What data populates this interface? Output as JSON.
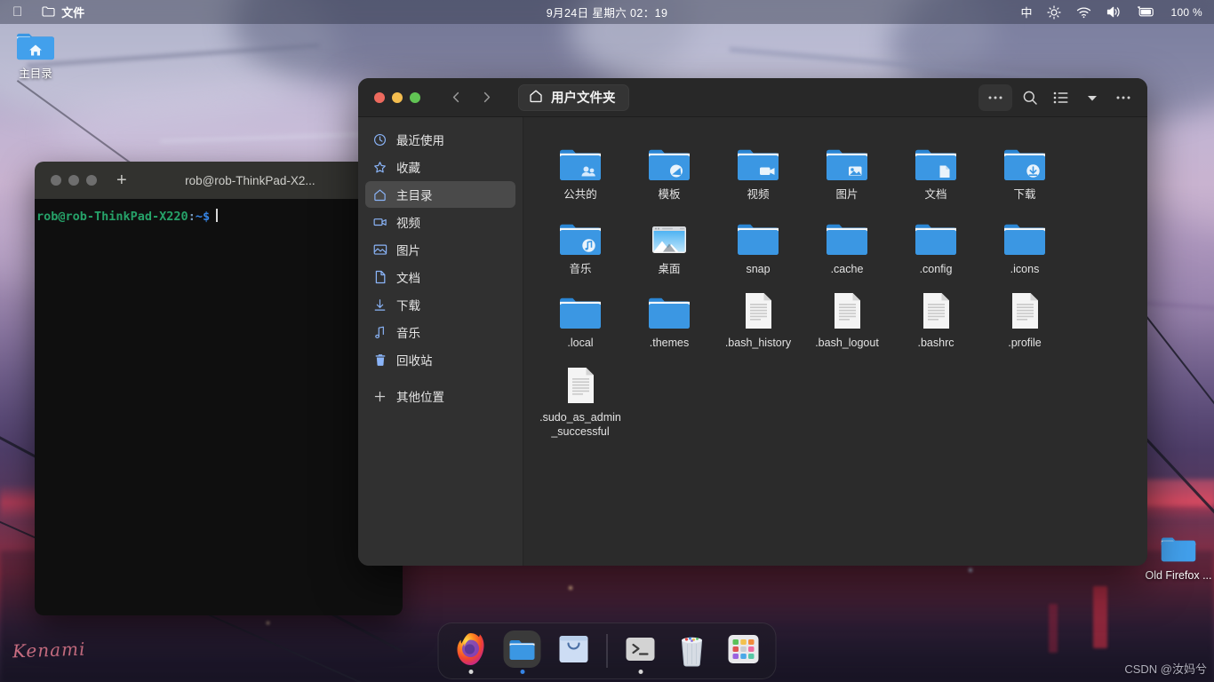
{
  "topbar": {
    "apple_logo": "",
    "app_icon": "folder-icon",
    "app_name": "文件",
    "datetime": "9月24日 星期六  02：19",
    "input_method": "中",
    "icons": [
      "brightness-icon",
      "wifi-icon",
      "volume-icon",
      "battery-icon"
    ],
    "battery": "100 %"
  },
  "desktop": {
    "icons": [
      {
        "name": "主目录",
        "type": "home-folder"
      },
      {
        "name": "Old Firefox ...",
        "type": "folder"
      }
    ],
    "wallpaper_signature": "Kenami",
    "watermark": "CSDN @汝妈兮"
  },
  "terminal": {
    "title": "rob@rob-ThinkPad-X2...",
    "new_tab_label": "+",
    "search_icon": "search-icon",
    "prompt_user": "rob@rob-ThinkPad-X220",
    "prompt_colon": ":",
    "prompt_path": "~",
    "prompt_dollar": "$"
  },
  "filemanager": {
    "window_controls": [
      "close",
      "minimize",
      "maximize"
    ],
    "back_label": "‹",
    "forward_label": "›",
    "path_icon": "home-icon",
    "path_label": "用户文件夹",
    "header_buttons": [
      {
        "name": "overflow-menu",
        "label": "···"
      },
      {
        "name": "search-icon",
        "label": ""
      },
      {
        "name": "list-view-icon",
        "label": ""
      },
      {
        "name": "view-options-chevron-icon",
        "label": ""
      },
      {
        "name": "hamburger-menu-icon",
        "label": "···"
      }
    ],
    "sidebar": [
      {
        "label": "最近使用",
        "icon": "clock-icon",
        "active": false
      },
      {
        "label": "收藏",
        "icon": "star-icon",
        "active": false
      },
      {
        "label": "主目录",
        "icon": "home-icon",
        "active": true
      },
      {
        "label": "视频",
        "icon": "video-camera-icon",
        "active": false
      },
      {
        "label": "图片",
        "icon": "image-icon",
        "active": false
      },
      {
        "label": "文档",
        "icon": "document-icon",
        "active": false
      },
      {
        "label": "下载",
        "icon": "download-arrow-icon",
        "active": false
      },
      {
        "label": "音乐",
        "icon": "music-note-icon",
        "active": false
      },
      {
        "label": "回收站",
        "icon": "trash-icon",
        "active": false
      },
      {
        "label": "其他位置",
        "icon": "plus-icon",
        "active": false
      }
    ],
    "files": [
      {
        "label": "公共的",
        "type": "folder",
        "emblem": "people"
      },
      {
        "label": "模板",
        "type": "folder",
        "emblem": "template"
      },
      {
        "label": "视频",
        "type": "folder",
        "emblem": "video"
      },
      {
        "label": "图片",
        "type": "folder",
        "emblem": "image"
      },
      {
        "label": "文档",
        "type": "folder",
        "emblem": "document"
      },
      {
        "label": "下载",
        "type": "folder",
        "emblem": "download"
      },
      {
        "label": "音乐",
        "type": "folder",
        "emblem": "music"
      },
      {
        "label": "桌面",
        "type": "desktop-thumb",
        "emblem": ""
      },
      {
        "label": "snap",
        "type": "folder",
        "emblem": ""
      },
      {
        "label": ".cache",
        "type": "folder",
        "emblem": ""
      },
      {
        "label": ".config",
        "type": "folder",
        "emblem": ""
      },
      {
        "label": ".icons",
        "type": "folder",
        "emblem": ""
      },
      {
        "label": ".local",
        "type": "folder",
        "emblem": ""
      },
      {
        "label": ".themes",
        "type": "folder",
        "emblem": ""
      },
      {
        "label": ".bash_history",
        "type": "text-file",
        "emblem": ""
      },
      {
        "label": ".bash_logout",
        "type": "text-file",
        "emblem": ""
      },
      {
        "label": ".bashrc",
        "type": "text-file",
        "emblem": ""
      },
      {
        "label": ".profile",
        "type": "text-file",
        "emblem": ""
      },
      {
        "label": ".sudo_as_admin_successful",
        "type": "text-file",
        "emblem": ""
      }
    ]
  },
  "dock": {
    "items": [
      {
        "name": "firefox",
        "label": "Firefox",
        "running": true,
        "dot": "white"
      },
      {
        "name": "files",
        "label": "文件",
        "running": true,
        "dot": "blue"
      },
      {
        "name": "software",
        "label": "软件",
        "running": false,
        "dot": ""
      },
      {
        "name": "separator",
        "label": "",
        "running": false,
        "dot": ""
      },
      {
        "name": "terminal",
        "label": "终端",
        "running": true,
        "dot": "white"
      },
      {
        "name": "trash",
        "label": "回收站",
        "running": false,
        "dot": ""
      },
      {
        "name": "apps",
        "label": "显示应用程序",
        "running": false,
        "dot": ""
      }
    ]
  },
  "colors": {
    "accent_blue": "#3584e4",
    "folder_blue": "#3b97e3",
    "sidebar_icon": "#8ab4f8",
    "terminal_green": "#26a269",
    "window_bg": "#2b2b2b"
  }
}
